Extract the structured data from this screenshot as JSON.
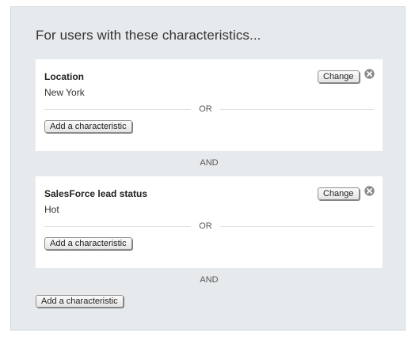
{
  "panel": {
    "heading": "For users with these characteristics...",
    "conditions": [
      {
        "title": "Location",
        "value": "New York",
        "change_label": "Change",
        "close_icon": "close-circle-icon",
        "or_label": "OR",
        "add_label": "Add a characteristic"
      },
      {
        "title": "SalesForce lead status",
        "value": "Hot",
        "change_label": "Change",
        "close_icon": "close-circle-icon",
        "or_label": "OR",
        "add_label": "Add a characteristic"
      }
    ],
    "and_labels": [
      "AND",
      "AND"
    ],
    "bottom_add_label": "Add a characteristic"
  }
}
